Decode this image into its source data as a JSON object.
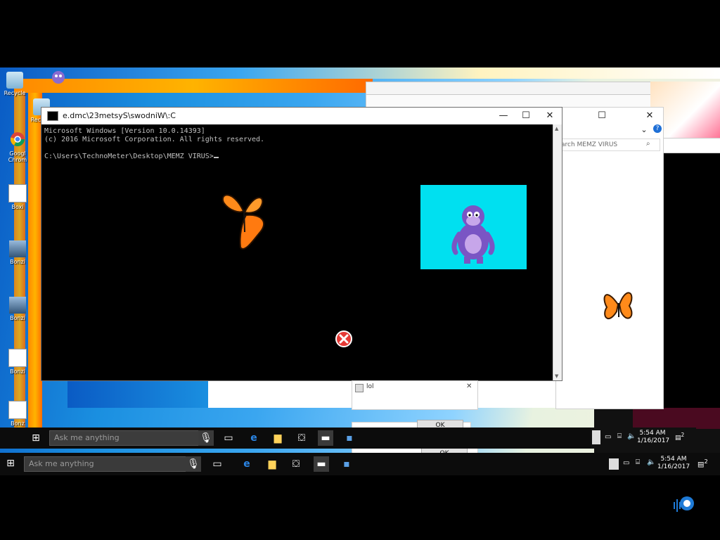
{
  "cmd": {
    "title": "C:\\Windows\\System32\\cmd.exe",
    "title_mirrored": "e.dmc\\23metsyS\\swodniW\\:C",
    "line1": "Microsoft Windows [Version 10.0.14393]",
    "line2": "(c) 2016 Microsoft Corporation. All rights reserved.",
    "prompt": "C:\\Users\\TechnoMeter\\Desktop\\MEMZ VIRUS>",
    "minimize": "—",
    "maximize": "☐",
    "close": "✕"
  },
  "explorer": {
    "search_placeholder": "arch MEMZ VIRUS",
    "maximize": "☐",
    "close": "✕",
    "expand": "⌄",
    "help": "?"
  },
  "msgbox": {
    "title": "lol",
    "close": "✕",
    "ok": "OK"
  },
  "desktop_icons": [
    {
      "label": "Recycle"
    },
    {
      "label": "Recycle"
    },
    {
      "label": "Googl Chrom"
    },
    {
      "label": "Boxi"
    },
    {
      "label": "Bonzi"
    },
    {
      "label": "Bonzi"
    },
    {
      "label": "Bonzi"
    },
    {
      "label": "Bonz Build"
    }
  ],
  "taskbar_lower": {
    "search_placeholder": "Ask me anything",
    "time": "5:54 AM",
    "date": "1/16/2017",
    "notifications": "2"
  },
  "taskbar_upper": {
    "search_placeholder": "Ask me anything",
    "time": "5:54 AM",
    "date": "1/16/2017",
    "notifications": "2"
  },
  "colors": {
    "bonzi_bg": "#00e0f0",
    "butterfly": "#ff8a1a",
    "desktop_blue": "#1a8fe0"
  }
}
